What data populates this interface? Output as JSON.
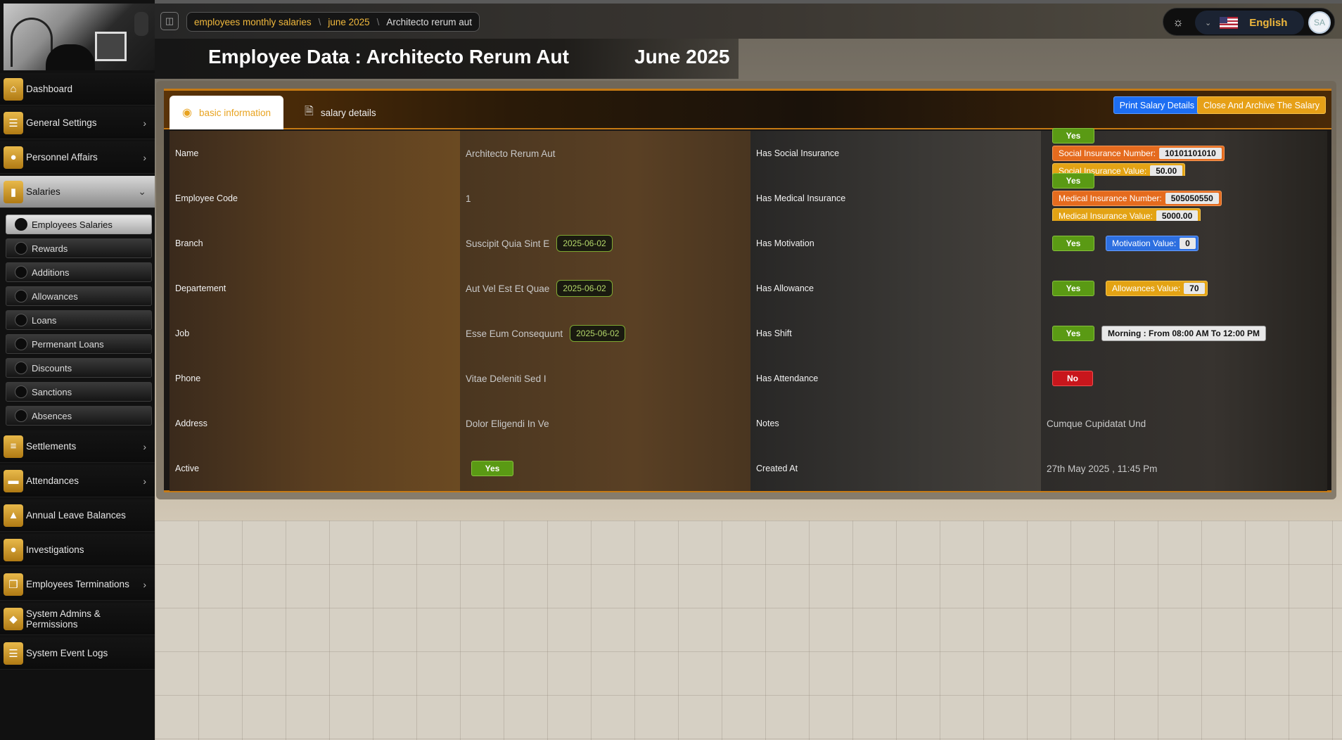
{
  "sidebar": {
    "items": [
      {
        "label": "Dashboard",
        "icon": "home-icon"
      },
      {
        "label": "General Settings",
        "icon": "sliders-icon"
      },
      {
        "label": "Personnel Affairs",
        "icon": "users-icon"
      },
      {
        "label": "Salaries",
        "icon": "salary-icon"
      },
      {
        "label": "Settlements",
        "icon": "list-icon"
      },
      {
        "label": "Attendances",
        "icon": "briefcase-icon"
      },
      {
        "label": "Annual Leave Balances",
        "icon": "bag-icon"
      },
      {
        "label": "Investigations",
        "icon": "circle-icon"
      },
      {
        "label": "Employees Terminations",
        "icon": "documents-icon"
      },
      {
        "label": "System Admins & Permissions",
        "icon": "shield-icon"
      },
      {
        "label": "System Event Logs",
        "icon": "lines-icon"
      }
    ],
    "sub_items": [
      {
        "label": "Employees Salaries"
      },
      {
        "label": "Rewards"
      },
      {
        "label": "Additions"
      },
      {
        "label": "Allowances"
      },
      {
        "label": "Loans"
      },
      {
        "label": "Permenant Loans"
      },
      {
        "label": "Discounts"
      },
      {
        "label": "Sanctions"
      },
      {
        "label": "Absences"
      }
    ]
  },
  "breadcrumb": {
    "items": [
      "employees monthly salaries",
      "june 2025",
      "Architecto rerum aut"
    ],
    "separator": "\\"
  },
  "topbar": {
    "language": "English",
    "avatar_initials": "SA"
  },
  "header": {
    "title": "Employee Data : Architecto Rerum Aut",
    "month": "June 2025"
  },
  "tabs": {
    "basic": "basic information",
    "salary": "salary details"
  },
  "actions": {
    "print": "Print Salary Details",
    "close": "Close And Archive The Salary"
  },
  "fields": {
    "name": {
      "label": "Name",
      "value": "Architecto Rerum Aut"
    },
    "code": {
      "label": "Employee Code",
      "value": "1"
    },
    "branch": {
      "label": "Branch",
      "value": "Suscipit Quia Sint E",
      "date": "2025-06-02"
    },
    "department": {
      "label": "Departement",
      "value": "Aut Vel Est Et Quae",
      "date": "2025-06-02"
    },
    "job": {
      "label": "Job",
      "value": "Esse Eum Consequunt",
      "date": "2025-06-02"
    },
    "phone": {
      "label": "Phone",
      "value": "Vitae Deleniti Sed I"
    },
    "address": {
      "label": "Address",
      "value": "Dolor Eligendi In Ve"
    },
    "active": {
      "label": "Active",
      "value": "Yes"
    },
    "social": {
      "label": "Has Social Insurance",
      "value": "Yes",
      "number_label": "Social Insurance Number:",
      "number": "10101101010",
      "value_label": "Social Insurance Value:",
      "amount": "50.00"
    },
    "medical": {
      "label": "Has Medical Insurance",
      "value": "Yes",
      "number_label": "Medical Insurance Number:",
      "number": "505050550",
      "value_label": "Medical Insurance Value:",
      "amount": "5000.00"
    },
    "motivation": {
      "label": "Has Motivation",
      "value": "Yes",
      "value_label": "Motivation Value:",
      "amount": "0"
    },
    "allowance": {
      "label": "Has Allowance",
      "value": "Yes",
      "value_label": "Allowances Value:",
      "amount": "70"
    },
    "shift": {
      "label": "Has Shift",
      "value": "Yes",
      "detail": "Morning : From 08:00 AM To 12:00 PM"
    },
    "attendance": {
      "label": "Has Attendance",
      "value": "No"
    },
    "notes": {
      "label": "Notes",
      "value": "Cumque Cupidatat Und"
    },
    "created": {
      "label": "Created At",
      "value": "27th May 2025 , 11:45 Pm"
    }
  },
  "colors": {
    "accent": "#e8a320",
    "yes": "#5a9a14",
    "no": "#c8161c",
    "print": "#1d6ef2"
  }
}
